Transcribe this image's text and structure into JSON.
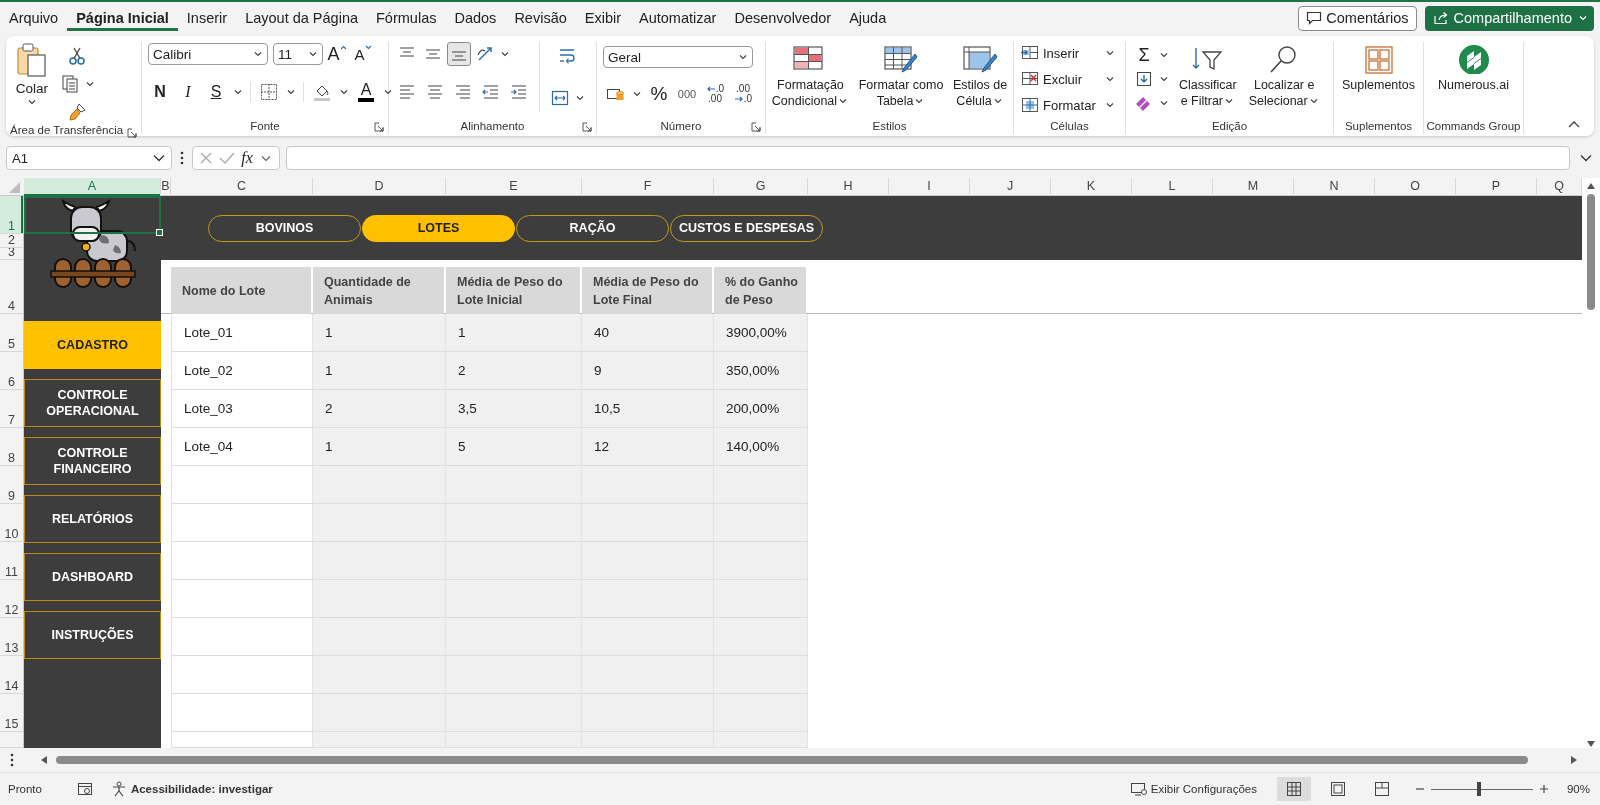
{
  "menu_tabs": [
    {
      "label": "Arquivo",
      "selected": false
    },
    {
      "label": "Página Inicial",
      "selected": true
    },
    {
      "label": "Inserir",
      "selected": false
    },
    {
      "label": "Layout da Página",
      "selected": false
    },
    {
      "label": "Fórmulas",
      "selected": false
    },
    {
      "label": "Dados",
      "selected": false
    },
    {
      "label": "Revisão",
      "selected": false
    },
    {
      "label": "Exibir",
      "selected": false
    },
    {
      "label": "Automatizar",
      "selected": false
    },
    {
      "label": "Desenvolvedor",
      "selected": false
    },
    {
      "label": "Ajuda",
      "selected": false
    }
  ],
  "comments_button": {
    "label": "Comentários"
  },
  "share_button": {
    "label": "Compartilhamento"
  },
  "ribbon": {
    "clipboard": {
      "label": "Área de Transferência",
      "paste": "Colar"
    },
    "font": {
      "label": "Fonte",
      "font_name": "Calibri",
      "font_size": "11",
      "grow": "A",
      "shrink": "A",
      "bold": "N",
      "italic": "I",
      "underline": "S",
      "font_color": "A"
    },
    "alignment": {
      "label": "Alinhamento",
      "vertical_align": [
        {
          "selected": false
        },
        {
          "selected": false
        },
        {
          "selected": true
        }
      ]
    },
    "number": {
      "label": "Número",
      "format": "Geral",
      "percent": "%",
      "thousands": "000",
      "add_decimal": [
        ".0",
        ".00"
      ],
      "remove_decimal": [
        ".00",
        ".0"
      ]
    },
    "styles": {
      "label": "Estilos",
      "buttons": [
        [
          "Formatação",
          "Condicional"
        ],
        [
          "Formatar como",
          "Tabela"
        ],
        [
          "Estilos de",
          "Célula"
        ]
      ]
    },
    "cells": {
      "label": "Células",
      "buttons": [
        "Inserir",
        "Excluir",
        "Formatar"
      ]
    },
    "editing": {
      "label": "Edição",
      "autosum": "Σ",
      "buttons": [
        [
          "Classificar",
          "e Filtrar"
        ],
        [
          "Localizar e",
          "Selecionar"
        ]
      ]
    },
    "addins": {
      "label": "Suplementos",
      "button": "Suplementos"
    },
    "commands": {
      "label": "Commands Group",
      "button": "Numerous.ai"
    }
  },
  "formula_bar": {
    "name_box": "A1",
    "function_label": "fx"
  },
  "column_headers": [
    {
      "label": "A",
      "selected": true
    },
    {
      "label": "B",
      "selected": false
    },
    {
      "label": "C",
      "selected": false
    },
    {
      "label": "D",
      "selected": false
    },
    {
      "label": "E",
      "selected": false
    },
    {
      "label": "F",
      "selected": false
    },
    {
      "label": "G",
      "selected": false
    },
    {
      "label": "H",
      "selected": false
    },
    {
      "label": "I",
      "selected": false
    },
    {
      "label": "J",
      "selected": false
    },
    {
      "label": "K",
      "selected": false
    },
    {
      "label": "L",
      "selected": false
    },
    {
      "label": "M",
      "selected": false
    },
    {
      "label": "N",
      "selected": false
    },
    {
      "label": "O",
      "selected": false
    },
    {
      "label": "P",
      "selected": false
    },
    {
      "label": "Q",
      "selected": false
    }
  ],
  "row_headers": [
    {
      "label": "1",
      "selected": true
    },
    {
      "label": "2",
      "selected": false
    },
    {
      "label": "3",
      "selected": false
    },
    {
      "label": "4",
      "selected": false
    },
    {
      "label": "5",
      "selected": false
    },
    {
      "label": "6",
      "selected": false
    },
    {
      "label": "7",
      "selected": false
    },
    {
      "label": "8",
      "selected": false
    },
    {
      "label": "9",
      "selected": false
    },
    {
      "label": "10",
      "selected": false
    },
    {
      "label": "11",
      "selected": false
    },
    {
      "label": "12",
      "selected": false
    },
    {
      "label": "13",
      "selected": false
    },
    {
      "label": "14",
      "selected": false
    },
    {
      "label": "15",
      "selected": false
    }
  ],
  "top_nav": [
    {
      "label": "BOVINOS",
      "selected": false
    },
    {
      "label": "LOTES",
      "selected": true
    },
    {
      "label": "RAÇÃO",
      "selected": false
    },
    {
      "label": "CUSTOS E DESPESAS",
      "selected": false
    }
  ],
  "side_menu": [
    {
      "label": "CADASTRO",
      "selected": true
    },
    {
      "label": "CONTROLE OPERACIONAL",
      "selected": false
    },
    {
      "label": "CONTROLE FINANCEIRO",
      "selected": false
    },
    {
      "label": "RELATÓRIOS",
      "selected": false
    },
    {
      "label": "DASHBOARD",
      "selected": false
    },
    {
      "label": "INSTRUÇÕES",
      "selected": false
    }
  ],
  "table": {
    "columns": [
      "Nome do Lote",
      "Quantidade de Animais",
      "Média de Peso do Lote Inicial",
      "Média de Peso do Lote Final",
      "% do Ganho de Peso"
    ],
    "rows": [
      [
        "Lote_01",
        "1",
        "1",
        "40",
        "3900,00%"
      ],
      [
        "Lote_02",
        "1",
        "2",
        "9",
        "350,00%"
      ],
      [
        "Lote_03",
        "2",
        "3,5",
        "10,5",
        "200,00%"
      ],
      [
        "Lote_04",
        "1",
        "5",
        "12",
        "140,00%"
      ]
    ]
  },
  "status_bar": {
    "mode": "Pronto",
    "accessibility": "Acessibilidade: investigar",
    "display_settings": "Exibir Configurações",
    "views": [
      {
        "selected": true
      },
      {
        "selected": false
      },
      {
        "selected": false
      }
    ],
    "zoom_slider": {
      "level": 0.47
    },
    "zoom": "90%"
  }
}
